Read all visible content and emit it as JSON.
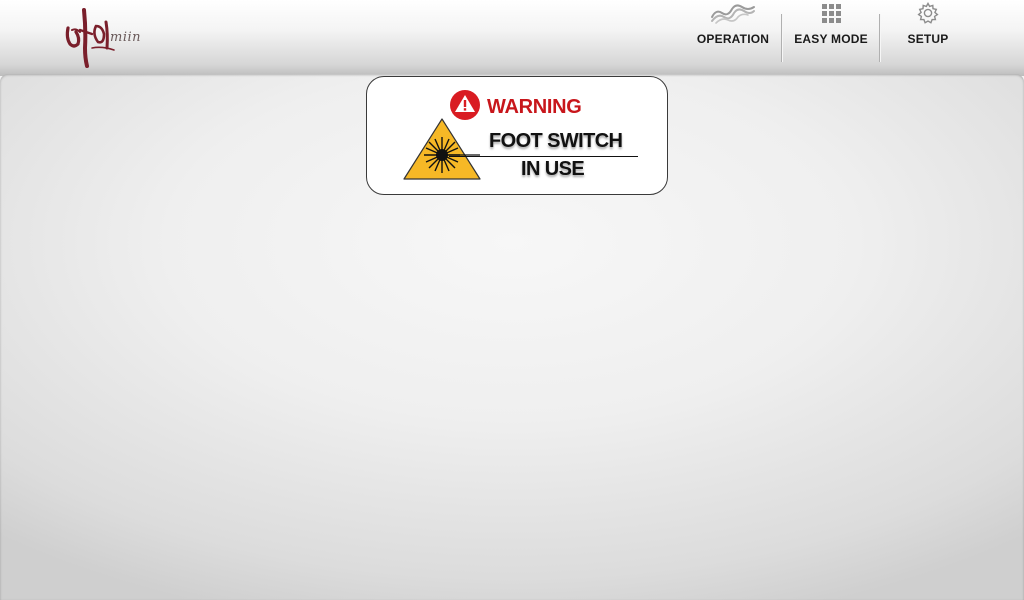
{
  "header": {
    "logo": {
      "text": "miin",
      "icon": "miin-logo"
    },
    "nav": [
      {
        "id": "operation",
        "label": "OPERATION",
        "icon": "wave-icon"
      },
      {
        "id": "easy_mode",
        "label": "EASY MODE",
        "icon": "grid-icon"
      },
      {
        "id": "setup",
        "label": "SETUP",
        "icon": "gear-icon"
      }
    ]
  },
  "warning": {
    "title": "WARNING",
    "message_line1": "FOOT SWITCH",
    "message_line2": "IN USE",
    "icons": [
      "alert-icon",
      "laser-warning-icon"
    ]
  },
  "colors": {
    "warning_red": "#c8161b",
    "laser_yellow": "#f6b826",
    "logo_maroon": "#7a1f2b"
  }
}
